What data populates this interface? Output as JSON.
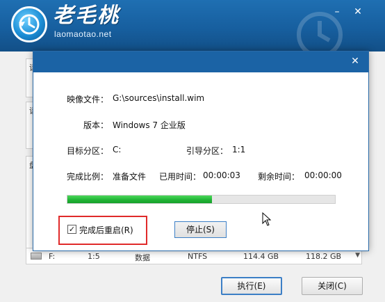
{
  "app": {
    "logo_title": "老毛桃",
    "logo_url": "laomaotao.net",
    "minimize_glyph": "–",
    "close_glyph": "✕"
  },
  "background": {
    "side_labels": [
      "请",
      "请",
      "盘"
    ],
    "disk_row": {
      "drive": "F:",
      "index": "1:5",
      "type": "数据",
      "fs": "NTFS",
      "size": "114.4 GB",
      "free": "118.2 GB"
    },
    "execute_button": "执行(E)",
    "close_button": "关闭(C)"
  },
  "dialog": {
    "close_glyph": "✕",
    "image_file_label": "映像文件：",
    "image_file_value": "G:\\sources\\install.wim",
    "version_label": "版本：",
    "version_value": "Windows 7 企业版",
    "target_label": "目标分区：",
    "target_value": "C:",
    "boot_label": "引导分区：",
    "boot_value": "1:1",
    "progress_label": "完成比例：",
    "progress_status": "准备文件",
    "elapsed_label": "已用时间：",
    "elapsed_value": "00:00:03",
    "remaining_label": "剩余时间：",
    "remaining_value": "00:00:00",
    "progress_fraction": 0.54,
    "reboot_label": "完成后重启(R)",
    "reboot_checked": true,
    "stop_button": "停止(S)"
  },
  "colors": {
    "header_blue": "#1f6fb2",
    "dialog_title_blue": "#1b63a5",
    "progress_green": "#1fb234",
    "highlight_red": "#e02a2a"
  },
  "icons": {
    "logo": "clock-arrow-logo",
    "disk": "drive-icon",
    "cursor": "mouse-pointer"
  }
}
